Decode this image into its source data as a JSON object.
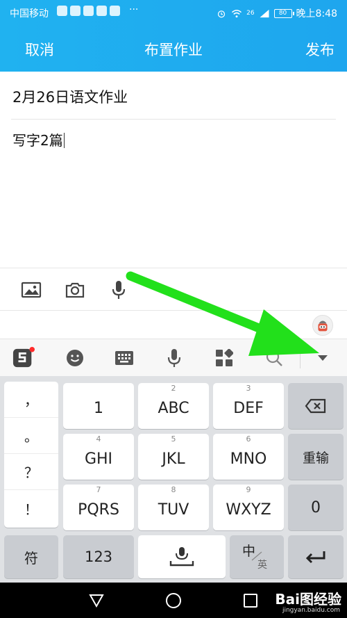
{
  "status_bar": {
    "carrier": "中国移动",
    "more": "···",
    "network": "26",
    "battery": "80",
    "time": "晚上8:48"
  },
  "nav": {
    "cancel": "取消",
    "title": "布置作业",
    "publish": "发布"
  },
  "form": {
    "title_value": "2月26日语文作业",
    "body_value": "写字2篇"
  },
  "attachments": [
    "image-icon",
    "camera-icon",
    "microphone-icon"
  ],
  "ime_toolbar": [
    "sogou-logo-icon",
    "emoji-icon",
    "keyboard-icon",
    "voice-icon",
    "apps-grid-icon",
    "search-icon",
    "collapse-keyboard-icon"
  ],
  "keyboard": {
    "punct": [
      "，",
      "。",
      "？",
      "！"
    ],
    "row1": [
      {
        "num": "",
        "label": "1"
      },
      {
        "num": "2",
        "label": "ABC"
      },
      {
        "num": "3",
        "label": "DEF"
      }
    ],
    "row2": [
      {
        "num": "4",
        "label": "GHI"
      },
      {
        "num": "5",
        "label": "JKL"
      },
      {
        "num": "6",
        "label": "MNO"
      }
    ],
    "row3": [
      {
        "num": "7",
        "label": "PQRS"
      },
      {
        "num": "8",
        "label": "TUV"
      },
      {
        "num": "9",
        "label": "WXYZ"
      }
    ],
    "reinput": "重输",
    "zero": "0",
    "symbol": "符",
    "num123": "123",
    "lang_zh": "中",
    "lang_en": "英"
  },
  "watermark": {
    "brand": "Bai图经验",
    "url": "jingyan.baidu.com"
  },
  "colors": {
    "header": "#1ea6ee",
    "arrow": "#22e01b",
    "keyboard_bg": "#dfe1e4",
    "badge": "#ff2b2b"
  }
}
